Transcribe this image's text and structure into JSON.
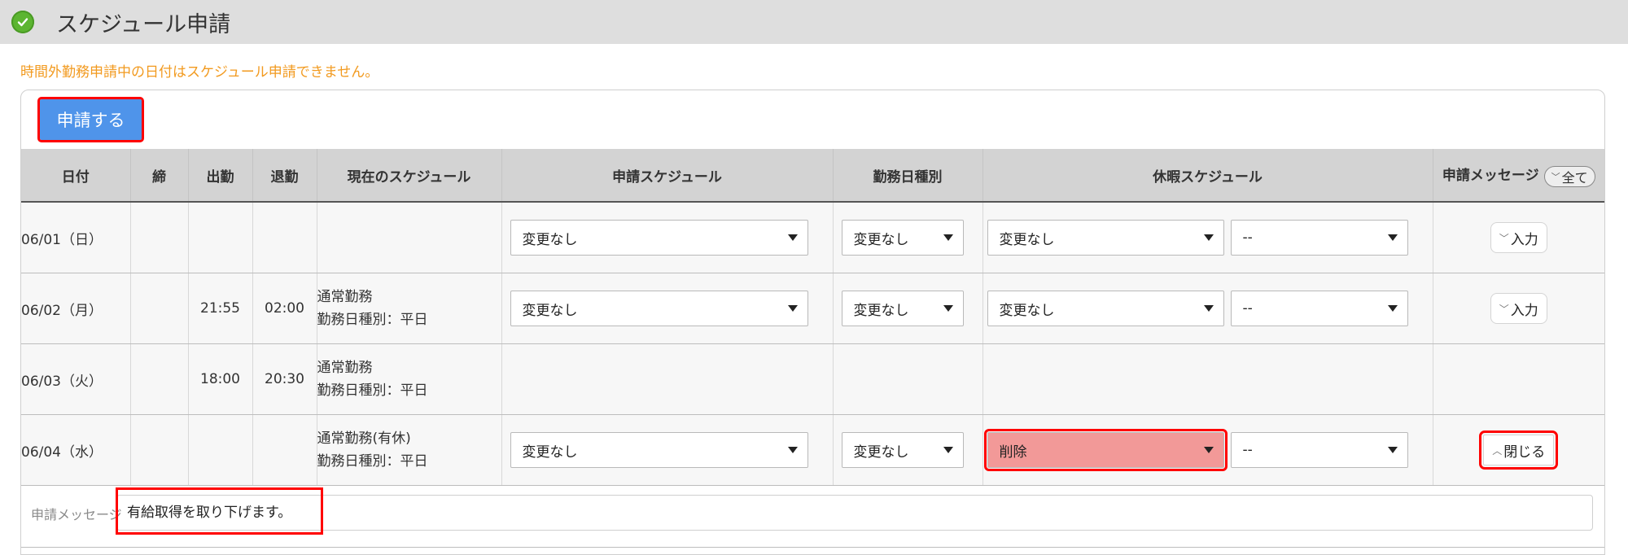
{
  "header": {
    "title": "スケジュール申請",
    "icon": "check-circle-icon",
    "icon_color": "#5cb531"
  },
  "notice": "時間外勤務申請中の日付はスケジュール申請できません。",
  "notice_color": "#f29a1f",
  "apply_button": "申請する",
  "apply_button_color": "#4f94ea",
  "columns": {
    "date": "日付",
    "close": "締",
    "in": "出勤",
    "out": "退勤",
    "current": "現在のスケジュール",
    "requested": "申請スケジュール",
    "daytype": "勤務日種別",
    "leave": "休暇スケジュール",
    "message": "申請メッセージ",
    "all": "全て"
  },
  "rows": [
    {
      "date": "06/01（日）",
      "in": "",
      "out": "",
      "current_1": "",
      "current_2": "",
      "requested": "変更なし",
      "daytype": "変更なし",
      "leave": "変更なし",
      "leave_sub": "--",
      "msg": "入力"
    },
    {
      "date": "06/02（月）",
      "in": "21:55",
      "out": "02:00",
      "current_1": "通常勤務",
      "current_2": "勤務日種別：平日",
      "requested": "変更なし",
      "daytype": "変更なし",
      "leave": "変更なし",
      "leave_sub": "--",
      "msg": "入力"
    },
    {
      "date": "06/03（火）",
      "in": "18:00",
      "out": "20:30",
      "current_1": "通常勤務",
      "current_2": "勤務日種別：平日"
    },
    {
      "date": "06/04（水）",
      "in": "",
      "out": "",
      "current_1": "通常勤務(有休)",
      "current_2": "勤務日種別：平日",
      "requested": "変更なし",
      "daytype": "変更なし",
      "leave": "削除",
      "leave_sub": "--",
      "msg": "閉じる"
    }
  ],
  "message_row": {
    "label": "申請メッセージ",
    "value": "有給取得を取り下げます。"
  },
  "highlight_color": "#ff0000",
  "deleted_color": "#f29998"
}
